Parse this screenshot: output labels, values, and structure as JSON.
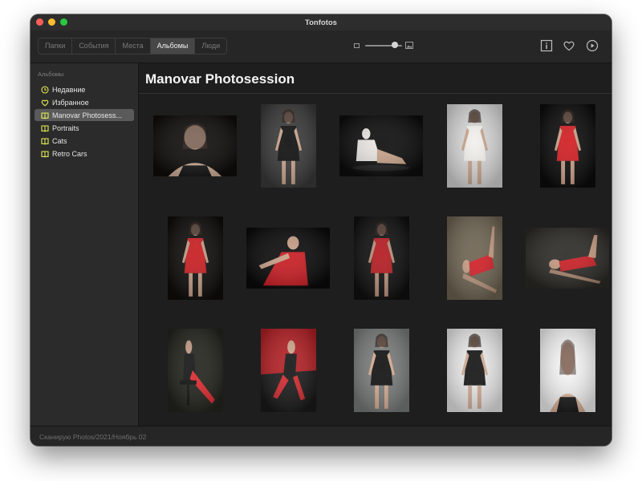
{
  "window": {
    "title": "Tonfotos"
  },
  "toolbar": {
    "tabs": [
      {
        "label": "Папки",
        "active": false
      },
      {
        "label": "События",
        "active": false
      },
      {
        "label": "Места",
        "active": false
      },
      {
        "label": "Альбомы",
        "active": true
      },
      {
        "label": "Люди",
        "active": false
      }
    ],
    "zoom_level": 0.8,
    "icons": [
      "info-icon",
      "heart-icon",
      "play-icon"
    ]
  },
  "sidebar": {
    "header": "Альбомы",
    "items": [
      {
        "label": "Недавние",
        "icon": "clock-icon",
        "selected": false
      },
      {
        "label": "Избранное",
        "icon": "heart-icon",
        "selected": false
      },
      {
        "label": "Manovar Photosess...",
        "icon": "album-icon",
        "selected": true
      },
      {
        "label": "Portraits",
        "icon": "album-icon",
        "selected": false
      },
      {
        "label": "Cats",
        "icon": "album-icon",
        "selected": false
      },
      {
        "label": "Retro Cars",
        "icon": "album-icon",
        "selected": false
      }
    ]
  },
  "main": {
    "album_title": "Manovar Photosession",
    "photos": [
      {
        "orientation": "landscape",
        "bg": "#0f0d0c",
        "subject": "#d2b098",
        "accent": "#161616",
        "pose": "portrait"
      },
      {
        "orientation": "portrait",
        "bg": "#3a3b3a",
        "subject": "#c9a48c",
        "accent": "#0e0e0e",
        "pose": "stand"
      },
      {
        "orientation": "landscape",
        "bg": "#0d0d0d",
        "subject": "#e9e6e2",
        "accent": "#2a2a2a",
        "pose": "sit"
      },
      {
        "orientation": "portrait",
        "bg": "#d8d8d8",
        "subject": "#c7a38a",
        "accent": "#f2f0ec",
        "pose": "stand"
      },
      {
        "orientation": "portrait",
        "bg": "#0d0c0c",
        "subject": "#c9a087",
        "accent": "#d11d22",
        "pose": "stand"
      },
      {
        "orientation": "portrait",
        "bg": "#0e0d0c",
        "subject": "#c09a83",
        "accent": "#c81c20",
        "pose": "stand"
      },
      {
        "orientation": "landscape",
        "bg": "#0c0b0b",
        "subject": "#c79e85",
        "accent": "#c91c22",
        "pose": "lean"
      },
      {
        "orientation": "portrait",
        "bg": "#101010",
        "subject": "#b58e77",
        "accent": "#b31a1f",
        "pose": "stand"
      },
      {
        "orientation": "portrait",
        "bg": "#6e6452",
        "subject": "#c69c83",
        "accent": "#d31f27",
        "pose": "floor"
      },
      {
        "orientation": "landscape",
        "bg": "#2c2b27",
        "subject": "#c59a80",
        "accent": "#c91e24",
        "pose": "floor"
      },
      {
        "orientation": "portrait",
        "bg": "#24241e",
        "subject": "#c49c85",
        "accent": "#e02a2f",
        "pose": "chair"
      },
      {
        "orientation": "portrait",
        "bg": "#b32025",
        "subject": "#d1a78d",
        "accent": "#161616",
        "pose": "squat"
      },
      {
        "orientation": "portrait",
        "bg": "#7b7c7c",
        "subject": "#d5ad93",
        "accent": "#101010",
        "pose": "stand"
      },
      {
        "orientation": "portrait",
        "bg": "#ececec",
        "subject": "#d2ad95",
        "accent": "#141414",
        "pose": "stand"
      },
      {
        "orientation": "portrait",
        "bg": "#f7f7f7",
        "subject": "#dcb49b",
        "accent": "#1a1a1a",
        "pose": "portrait"
      }
    ]
  },
  "status": {
    "text": "Сканирую Photos/2021/Ноябрь 02"
  },
  "colors": {
    "background": "#1e1e1e",
    "sidebar": "#2b2b2b",
    "toolbar": "#262626",
    "selected": "#5a5a5a",
    "icon_yellow": "#e7ec55"
  }
}
